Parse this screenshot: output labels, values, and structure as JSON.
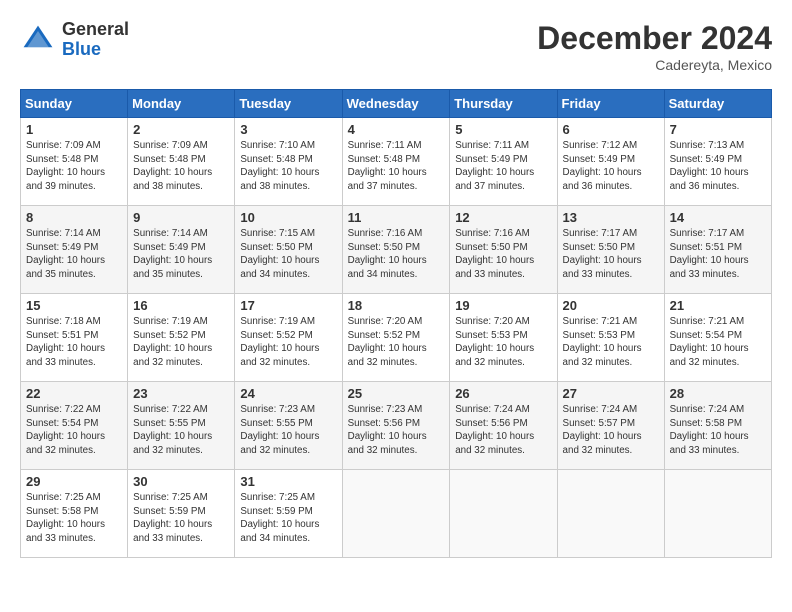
{
  "logo": {
    "line1": "General",
    "line2": "Blue"
  },
  "header": {
    "month_title": "December 2024",
    "subtitle": "Cadereyta, Mexico"
  },
  "weekdays": [
    "Sunday",
    "Monday",
    "Tuesday",
    "Wednesday",
    "Thursday",
    "Friday",
    "Saturday"
  ],
  "weeks": [
    [
      {
        "day": "1",
        "sunrise": "Sunrise: 7:09 AM",
        "sunset": "Sunset: 5:48 PM",
        "daylight": "Daylight: 10 hours and 39 minutes."
      },
      {
        "day": "2",
        "sunrise": "Sunrise: 7:09 AM",
        "sunset": "Sunset: 5:48 PM",
        "daylight": "Daylight: 10 hours and 38 minutes."
      },
      {
        "day": "3",
        "sunrise": "Sunrise: 7:10 AM",
        "sunset": "Sunset: 5:48 PM",
        "daylight": "Daylight: 10 hours and 38 minutes."
      },
      {
        "day": "4",
        "sunrise": "Sunrise: 7:11 AM",
        "sunset": "Sunset: 5:48 PM",
        "daylight": "Daylight: 10 hours and 37 minutes."
      },
      {
        "day": "5",
        "sunrise": "Sunrise: 7:11 AM",
        "sunset": "Sunset: 5:49 PM",
        "daylight": "Daylight: 10 hours and 37 minutes."
      },
      {
        "day": "6",
        "sunrise": "Sunrise: 7:12 AM",
        "sunset": "Sunset: 5:49 PM",
        "daylight": "Daylight: 10 hours and 36 minutes."
      },
      {
        "day": "7",
        "sunrise": "Sunrise: 7:13 AM",
        "sunset": "Sunset: 5:49 PM",
        "daylight": "Daylight: 10 hours and 36 minutes."
      }
    ],
    [
      {
        "day": "8",
        "sunrise": "Sunrise: 7:14 AM",
        "sunset": "Sunset: 5:49 PM",
        "daylight": "Daylight: 10 hours and 35 minutes."
      },
      {
        "day": "9",
        "sunrise": "Sunrise: 7:14 AM",
        "sunset": "Sunset: 5:49 PM",
        "daylight": "Daylight: 10 hours and 35 minutes."
      },
      {
        "day": "10",
        "sunrise": "Sunrise: 7:15 AM",
        "sunset": "Sunset: 5:50 PM",
        "daylight": "Daylight: 10 hours and 34 minutes."
      },
      {
        "day": "11",
        "sunrise": "Sunrise: 7:16 AM",
        "sunset": "Sunset: 5:50 PM",
        "daylight": "Daylight: 10 hours and 34 minutes."
      },
      {
        "day": "12",
        "sunrise": "Sunrise: 7:16 AM",
        "sunset": "Sunset: 5:50 PM",
        "daylight": "Daylight: 10 hours and 33 minutes."
      },
      {
        "day": "13",
        "sunrise": "Sunrise: 7:17 AM",
        "sunset": "Sunset: 5:50 PM",
        "daylight": "Daylight: 10 hours and 33 minutes."
      },
      {
        "day": "14",
        "sunrise": "Sunrise: 7:17 AM",
        "sunset": "Sunset: 5:51 PM",
        "daylight": "Daylight: 10 hours and 33 minutes."
      }
    ],
    [
      {
        "day": "15",
        "sunrise": "Sunrise: 7:18 AM",
        "sunset": "Sunset: 5:51 PM",
        "daylight": "Daylight: 10 hours and 33 minutes."
      },
      {
        "day": "16",
        "sunrise": "Sunrise: 7:19 AM",
        "sunset": "Sunset: 5:52 PM",
        "daylight": "Daylight: 10 hours and 32 minutes."
      },
      {
        "day": "17",
        "sunrise": "Sunrise: 7:19 AM",
        "sunset": "Sunset: 5:52 PM",
        "daylight": "Daylight: 10 hours and 32 minutes."
      },
      {
        "day": "18",
        "sunrise": "Sunrise: 7:20 AM",
        "sunset": "Sunset: 5:52 PM",
        "daylight": "Daylight: 10 hours and 32 minutes."
      },
      {
        "day": "19",
        "sunrise": "Sunrise: 7:20 AM",
        "sunset": "Sunset: 5:53 PM",
        "daylight": "Daylight: 10 hours and 32 minutes."
      },
      {
        "day": "20",
        "sunrise": "Sunrise: 7:21 AM",
        "sunset": "Sunset: 5:53 PM",
        "daylight": "Daylight: 10 hours and 32 minutes."
      },
      {
        "day": "21",
        "sunrise": "Sunrise: 7:21 AM",
        "sunset": "Sunset: 5:54 PM",
        "daylight": "Daylight: 10 hours and 32 minutes."
      }
    ],
    [
      {
        "day": "22",
        "sunrise": "Sunrise: 7:22 AM",
        "sunset": "Sunset: 5:54 PM",
        "daylight": "Daylight: 10 hours and 32 minutes."
      },
      {
        "day": "23",
        "sunrise": "Sunrise: 7:22 AM",
        "sunset": "Sunset: 5:55 PM",
        "daylight": "Daylight: 10 hours and 32 minutes."
      },
      {
        "day": "24",
        "sunrise": "Sunrise: 7:23 AM",
        "sunset": "Sunset: 5:55 PM",
        "daylight": "Daylight: 10 hours and 32 minutes."
      },
      {
        "day": "25",
        "sunrise": "Sunrise: 7:23 AM",
        "sunset": "Sunset: 5:56 PM",
        "daylight": "Daylight: 10 hours and 32 minutes."
      },
      {
        "day": "26",
        "sunrise": "Sunrise: 7:24 AM",
        "sunset": "Sunset: 5:56 PM",
        "daylight": "Daylight: 10 hours and 32 minutes."
      },
      {
        "day": "27",
        "sunrise": "Sunrise: 7:24 AM",
        "sunset": "Sunset: 5:57 PM",
        "daylight": "Daylight: 10 hours and 32 minutes."
      },
      {
        "day": "28",
        "sunrise": "Sunrise: 7:24 AM",
        "sunset": "Sunset: 5:58 PM",
        "daylight": "Daylight: 10 hours and 33 minutes."
      }
    ],
    [
      {
        "day": "29",
        "sunrise": "Sunrise: 7:25 AM",
        "sunset": "Sunset: 5:58 PM",
        "daylight": "Daylight: 10 hours and 33 minutes."
      },
      {
        "day": "30",
        "sunrise": "Sunrise: 7:25 AM",
        "sunset": "Sunset: 5:59 PM",
        "daylight": "Daylight: 10 hours and 33 minutes."
      },
      {
        "day": "31",
        "sunrise": "Sunrise: 7:25 AM",
        "sunset": "Sunset: 5:59 PM",
        "daylight": "Daylight: 10 hours and 34 minutes."
      },
      null,
      null,
      null,
      null
    ]
  ]
}
